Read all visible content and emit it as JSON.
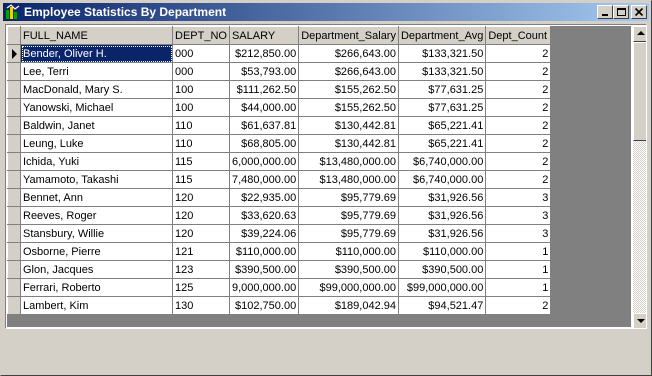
{
  "window": {
    "title": "Employee Statistics By Department",
    "controls": {
      "minimize": "_",
      "maximize": "□",
      "close": "×"
    }
  },
  "grid": {
    "columns": [
      "FULL_NAME",
      "DEPT_NO",
      "SALARY",
      "Department_Salary",
      "Department_Avg",
      "Dept_Count"
    ],
    "selected_row": 0,
    "selected_column": "FULL_NAME",
    "rows": [
      [
        "Bender, Oliver H.",
        "000",
        "$212,850.00",
        "$266,643.00",
        "$133,321.50",
        "2"
      ],
      [
        "Lee, Terri",
        "000",
        "$53,793.00",
        "$266,643.00",
        "$133,321.50",
        "2"
      ],
      [
        "MacDonald, Mary S.",
        "100",
        "$111,262.50",
        "$155,262.50",
        "$77,631.25",
        "2"
      ],
      [
        "Yanowski, Michael",
        "100",
        "$44,000.00",
        "$155,262.50",
        "$77,631.25",
        "2"
      ],
      [
        "Baldwin, Janet",
        "110",
        "$61,637.81",
        "$130,442.81",
        "$65,221.41",
        "2"
      ],
      [
        "Leung, Luke",
        "110",
        "$68,805.00",
        "$130,442.81",
        "$65,221.41",
        "2"
      ],
      [
        "Ichida, Yuki",
        "115",
        "6,000,000.00",
        "$13,480,000.00",
        "$6,740,000.00",
        "2"
      ],
      [
        "Yamamoto, Takashi",
        "115",
        "7,480,000.00",
        "$13,480,000.00",
        "$6,740,000.00",
        "2"
      ],
      [
        "Bennet, Ann",
        "120",
        "$22,935.00",
        "$95,779.69",
        "$31,926.56",
        "3"
      ],
      [
        "Reeves, Roger",
        "120",
        "$33,620.63",
        "$95,779.69",
        "$31,926.56",
        "3"
      ],
      [
        "Stansbury, Willie",
        "120",
        "$39,224.06",
        "$95,779.69",
        "$31,926.56",
        "3"
      ],
      [
        "Osborne, Pierre",
        "121",
        "$110,000.00",
        "$110,000.00",
        "$110,000.00",
        "1"
      ],
      [
        "Glon, Jacques",
        "123",
        "$390,500.00",
        "$390,500.00",
        "$390,500.00",
        "1"
      ],
      [
        "Ferrari, Roberto",
        "125",
        "9,000,000.00",
        "$99,000,000.00",
        "$99,000,000.00",
        "1"
      ],
      [
        "Lambert, Kim",
        "130",
        "$102,750.00",
        "$189,042.94",
        "$94,521.47",
        "2"
      ]
    ]
  },
  "colors": {
    "title_gradient_start": "#0a246a",
    "title_gradient_end": "#a6caf0",
    "selection": "#0a246a",
    "face": "#d4d0c8"
  }
}
